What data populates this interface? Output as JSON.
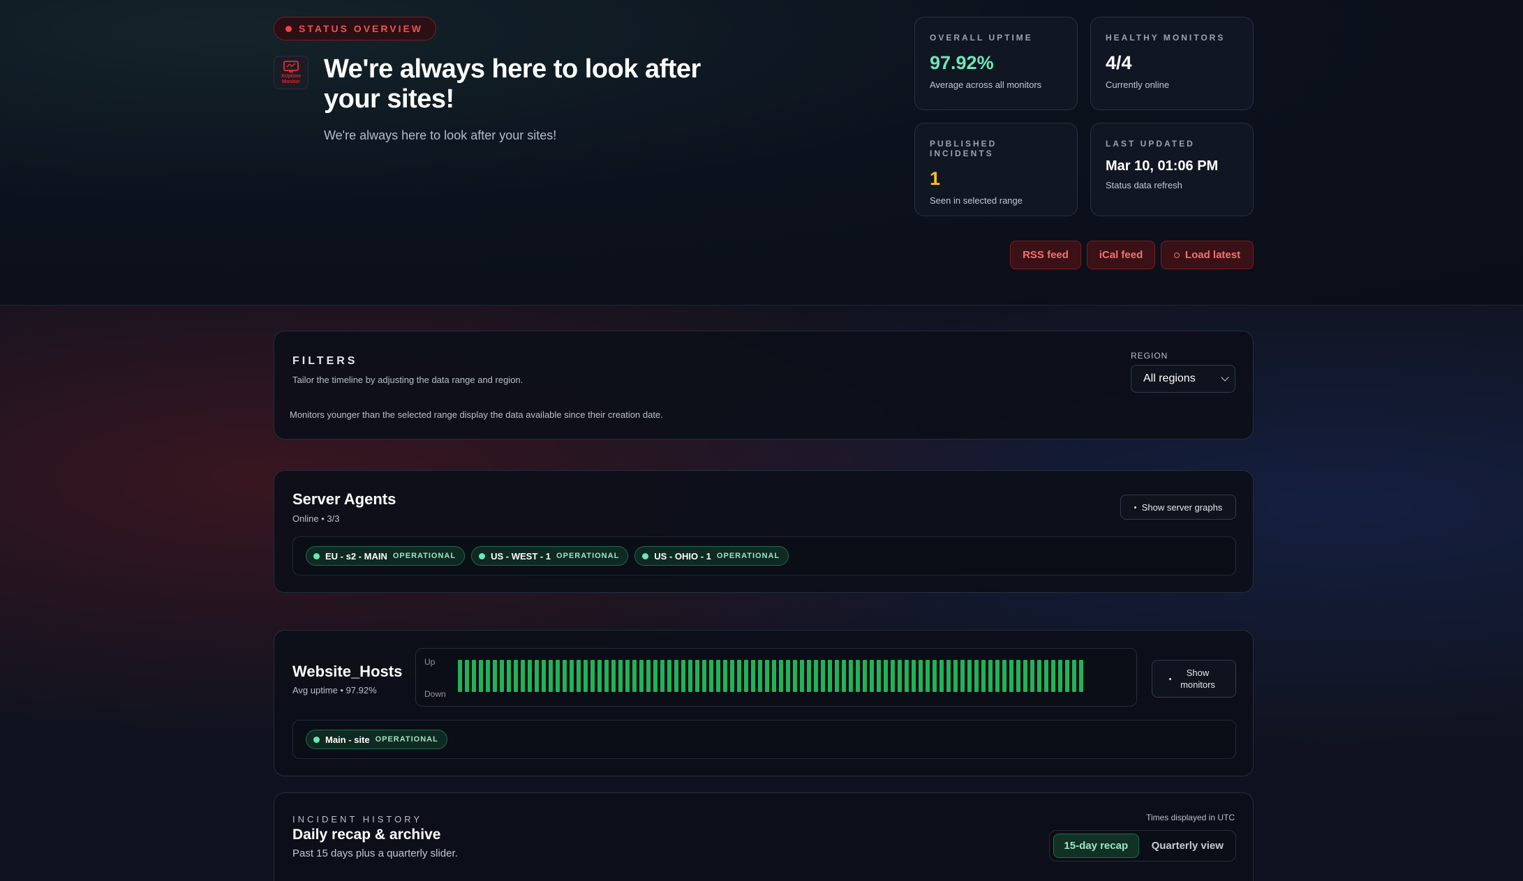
{
  "hero": {
    "badge": "STATUS OVERVIEW",
    "logo_text": "XUptime Monitor",
    "title": "We're always here to look after your sites!",
    "subtitle": "We're always here to look after your sites!"
  },
  "stats": [
    {
      "label": "OVERALL UPTIME",
      "value": "97.92%",
      "note": "Average across all monitors"
    },
    {
      "label": "HEALTHY MONITORS",
      "value": "4/4",
      "note": "Currently online"
    },
    {
      "label": "PUBLISHED INCIDENTS",
      "value": "1",
      "note": "Seen in selected range"
    },
    {
      "label": "LAST UPDATED",
      "value": "Mar 10, 01:06 PM",
      "note": "Status data refresh"
    }
  ],
  "actions": {
    "rss": "RSS feed",
    "ical": "iCal feed",
    "load": "Load latest"
  },
  "filters": {
    "title": "FILTERS",
    "description": "Tailor the timeline by adjusting the data range and region.",
    "note": "Monitors younger than the selected range display the data available since their creation date.",
    "region_label": "REGION",
    "region_value": "All regions"
  },
  "agents": {
    "title": "Server Agents",
    "subtitle": "Online • 3/3",
    "toggle": "Show server graphs",
    "items": [
      {
        "name": "EU - s2 - MAIN",
        "status": "OPERATIONAL"
      },
      {
        "name": "US - WEST - 1",
        "status": "OPERATIONAL"
      },
      {
        "name": "US - OHIO - 1",
        "status": "OPERATIONAL"
      }
    ]
  },
  "group": {
    "title": "Website_Hosts",
    "subtitle": "Avg uptime • 97.92%",
    "graph_up": "Up",
    "graph_down": "Down",
    "bar_count": 90,
    "toggle": "Show monitors",
    "monitors": [
      {
        "name": "Main - site",
        "status": "OPERATIONAL"
      }
    ]
  },
  "incidents": {
    "overline": "INCIDENT HISTORY",
    "title": "Daily recap & archive",
    "subtitle": "Past 15 days plus a quarterly slider.",
    "timezone": "Times displayed in UTC",
    "tabs": [
      "15-day recap",
      "Quarterly view"
    ]
  },
  "colors": {
    "accent_red": "#ef4444",
    "operational_green": "#22c55e",
    "uptime_green": "#6ee7b7",
    "incident_yellow": "#fbbf24"
  }
}
